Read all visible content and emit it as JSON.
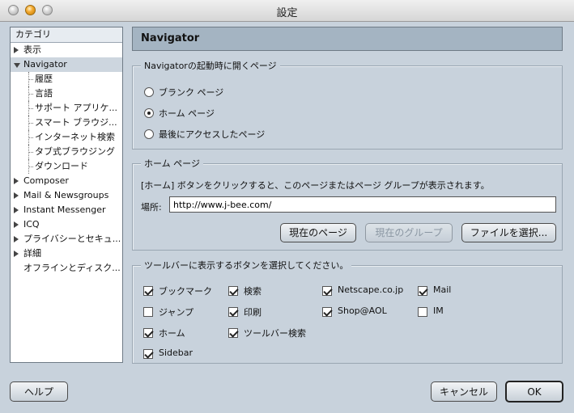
{
  "window": {
    "title": "設定"
  },
  "sidebar": {
    "header": "カテゴリ",
    "items": [
      {
        "label": "表示",
        "expander": "right",
        "level": 0,
        "selected": false
      },
      {
        "label": "Navigator",
        "expander": "down",
        "level": 0,
        "selected": true
      },
      {
        "label": "履歴",
        "level": 1
      },
      {
        "label": "言語",
        "level": 1
      },
      {
        "label": "サポート アプリケ...",
        "level": 1
      },
      {
        "label": "スマート ブラウジ...",
        "level": 1
      },
      {
        "label": "インターネット検索",
        "level": 1
      },
      {
        "label": "タブ式ブラウジング",
        "level": 1
      },
      {
        "label": "ダウンロード",
        "level": 1
      },
      {
        "label": "Composer",
        "expander": "right",
        "level": 0
      },
      {
        "label": "Mail & Newsgroups",
        "expander": "right",
        "level": 0
      },
      {
        "label": "Instant Messenger",
        "expander": "right",
        "level": 0
      },
      {
        "label": "ICQ",
        "expander": "right",
        "level": 0
      },
      {
        "label": "プライバシーとセキュ...",
        "expander": "right",
        "level": 0
      },
      {
        "label": "詳細",
        "expander": "right",
        "level": 0
      },
      {
        "label": "オフラインとディスク...",
        "level": 0
      }
    ]
  },
  "main": {
    "panel_title": "Navigator",
    "startup": {
      "legend": "Navigatorの起動時に開くページ",
      "options": [
        {
          "label": "ブランク ページ",
          "checked": false
        },
        {
          "label": "ホーム ページ",
          "checked": true
        },
        {
          "label": "最後にアクセスしたページ",
          "checked": false
        }
      ]
    },
    "homepage": {
      "legend": "ホーム ページ",
      "description": "[ホーム] ボタンをクリックすると、このページまたはページ グループが表示されます。",
      "location_label": "場所:",
      "location_value": "http://www.j-bee.com/",
      "buttons": {
        "current_page": "現在のページ",
        "current_group": "現在のグループ",
        "choose_file": "ファイルを選択..."
      }
    },
    "toolbar": {
      "legend": "ツールバーに表示するボタンを選択してください。",
      "items": [
        {
          "label": "ブックマーク",
          "checked": true
        },
        {
          "label": "検索",
          "checked": true
        },
        {
          "label": "Netscape.co.jp",
          "checked": true
        },
        {
          "label": "Mail",
          "checked": true
        },
        {
          "label": "ジャンプ",
          "checked": false
        },
        {
          "label": "印刷",
          "checked": true
        },
        {
          "label": "Shop@AOL",
          "checked": true
        },
        {
          "label": "IM",
          "checked": false
        },
        {
          "label": "ホーム",
          "checked": true
        },
        {
          "label": "ツールバー検索",
          "checked": true
        },
        {
          "label": "Sidebar",
          "checked": true
        }
      ]
    }
  },
  "footer": {
    "help": "ヘルプ",
    "cancel": "キャンセル",
    "ok": "OK"
  }
}
